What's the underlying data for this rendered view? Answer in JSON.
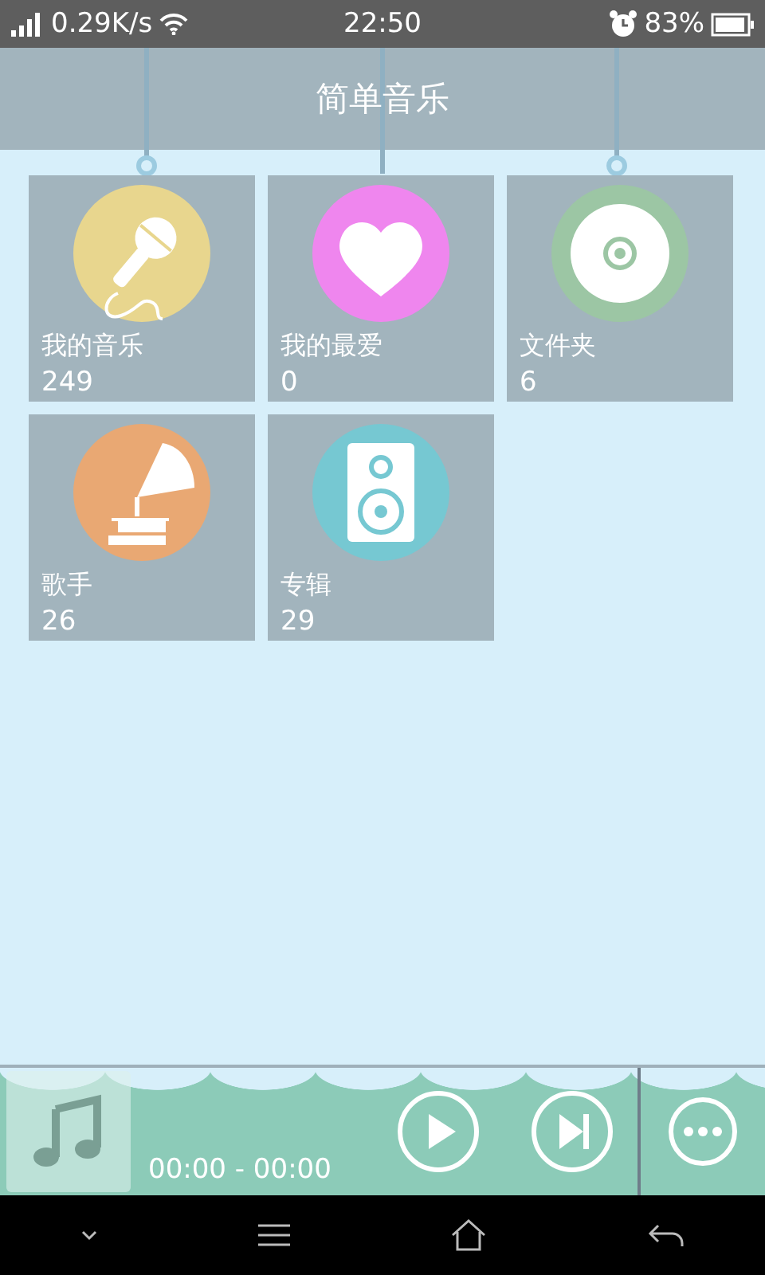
{
  "status_bar": {
    "speed": "0.29K/s",
    "time": "22:50",
    "battery": "83%"
  },
  "title": "简单音乐",
  "tiles": [
    {
      "kind": "mic",
      "label": "我的音乐",
      "count": "249",
      "color": "#e8d68e"
    },
    {
      "kind": "heart",
      "label": "我的最爱",
      "count": "0",
      "color": "#ef86ee"
    },
    {
      "kind": "disc",
      "label": "文件夹",
      "count": "6",
      "color": "#9cc6a4"
    },
    {
      "kind": "gramophone",
      "label": "歌手",
      "count": "26",
      "color": "#e9a873"
    },
    {
      "kind": "speaker",
      "label": "专辑",
      "count": "29",
      "color": "#76c8d2"
    }
  ],
  "player": {
    "time": "00:00 - 00:00"
  }
}
